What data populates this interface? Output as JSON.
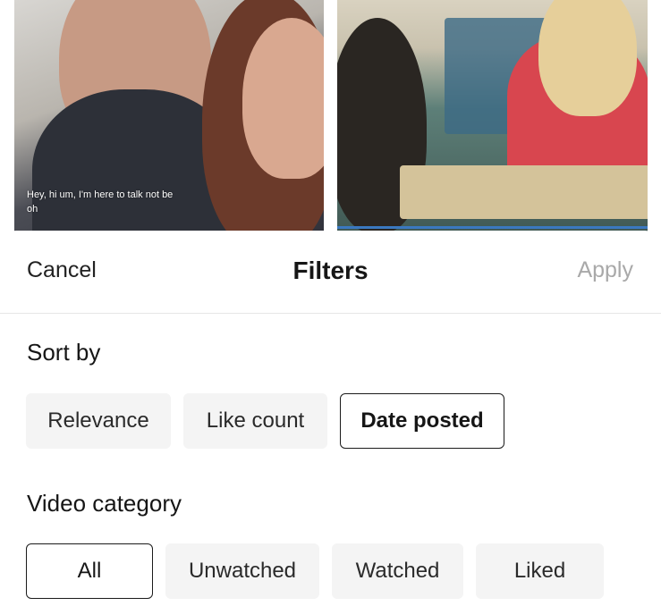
{
  "background": {
    "left_video": {
      "caption": "Hey, hi um, I'm here to talk not be\noh"
    }
  },
  "sheet": {
    "cancel_label": "Cancel",
    "title": "Filters",
    "apply_label": "Apply",
    "sort_by": {
      "title": "Sort by",
      "options": [
        "Relevance",
        "Like count",
        "Date posted"
      ],
      "selected": "Date posted"
    },
    "video_category": {
      "title": "Video category",
      "options": [
        "All",
        "Unwatched",
        "Watched",
        "Liked"
      ],
      "selected": "All"
    }
  },
  "colors": {
    "accent_border": "#1b1b1b",
    "chip_bg": "#f4f4f4",
    "disabled_text": "#a9a9a9"
  }
}
